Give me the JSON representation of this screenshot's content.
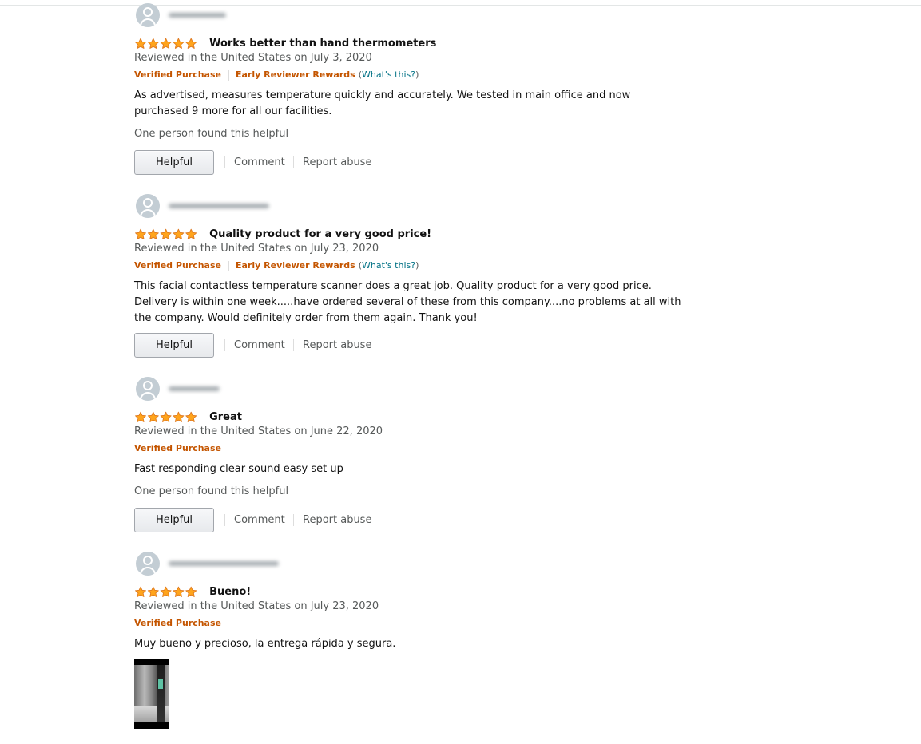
{
  "colors": {
    "star": "#ffa41c",
    "badge": "#c45500",
    "link": "#007185",
    "muted_text": "#565959"
  },
  "star_rating_max": 5,
  "reviews": [
    {
      "rating": 5,
      "title": "Works better than hand thermometers",
      "date": "Reviewed in the United States on July 3, 2020",
      "verified": "Verified Purchase",
      "early_reviewer": "Early Reviewer Rewards",
      "whats_this_open": "(",
      "whats_this": "What's this?",
      "whats_this_close": ")",
      "body": "As advertised, measures temperature quickly and accurately. We tested in main office and now purchased 9 more for all our facilities.",
      "helpful_count": "One person found this helpful",
      "helpful_label": "Helpful",
      "comment_label": "Comment",
      "report_label": "Report abuse"
    },
    {
      "rating": 5,
      "title": "Quality product for a very good price!",
      "date": "Reviewed in the United States on July 23, 2020",
      "verified": "Verified Purchase",
      "early_reviewer": "Early Reviewer Rewards",
      "whats_this_open": "(",
      "whats_this": "What's this?",
      "whats_this_close": ")",
      "body": "This facial contactless temperature scanner does a great job. Quality product for a very good price. Delivery is within one week.....have ordered several of these from this company....no problems at all with the company. Would definitely order from them again. Thank you!",
      "helpful_label": "Helpful",
      "comment_label": "Comment",
      "report_label": "Report abuse"
    },
    {
      "rating": 5,
      "title": "Great",
      "date": "Reviewed in the United States on June 22, 2020",
      "verified": "Verified Purchase",
      "body": "Fast responding clear sound easy set up",
      "helpful_count": "One person found this helpful",
      "helpful_label": "Helpful",
      "comment_label": "Comment",
      "report_label": "Report abuse"
    },
    {
      "rating": 5,
      "title": "Bueno!",
      "date": "Reviewed in the United States on July 23, 2020",
      "verified": "Verified Purchase",
      "body": "Muy bueno y precioso, la entrega rápida y segura."
    }
  ]
}
